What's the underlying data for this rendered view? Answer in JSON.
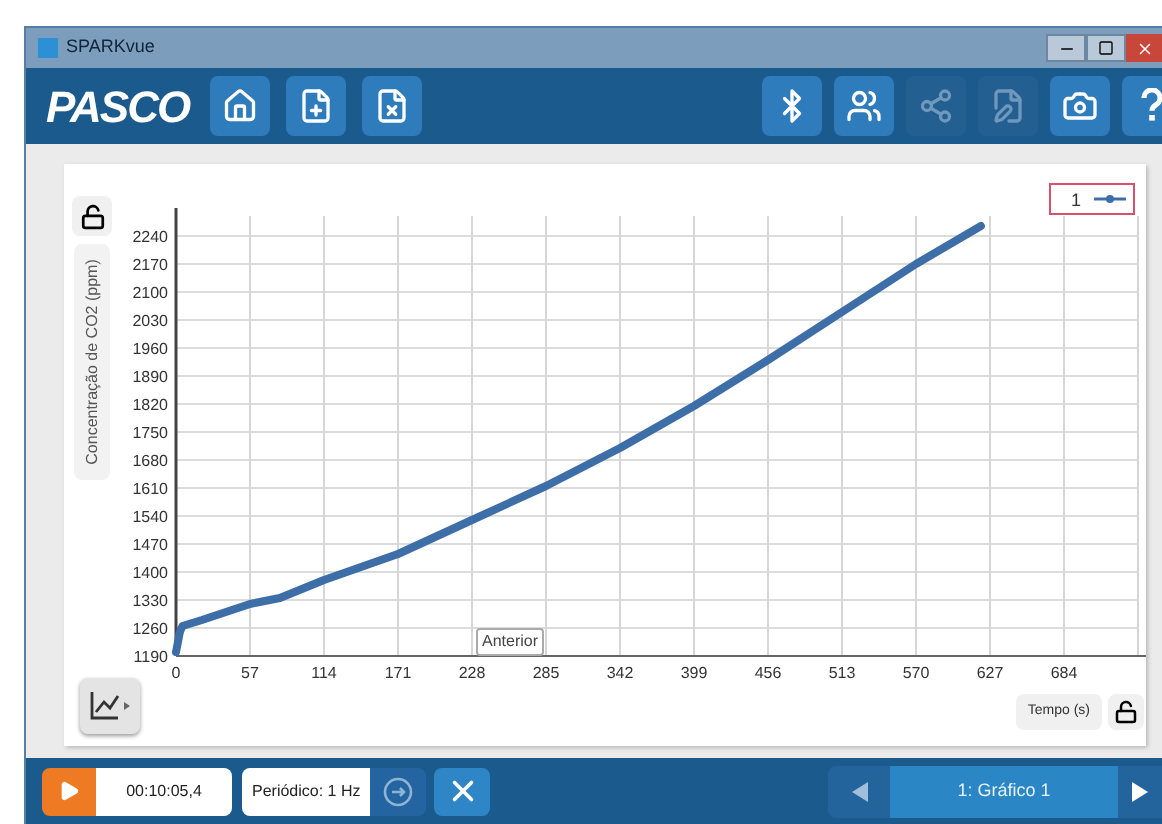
{
  "window": {
    "title": "SPARKvue"
  },
  "toolbar": {
    "logo": "PASCO",
    "left_buttons": [
      {
        "kind": "home",
        "disabled": false
      },
      {
        "kind": "new-page",
        "disabled": false
      },
      {
        "kind": "delete-page",
        "disabled": false
      }
    ],
    "right_buttons": [
      {
        "kind": "bluetooth",
        "disabled": false
      },
      {
        "kind": "users",
        "disabled": false
      },
      {
        "kind": "share",
        "disabled": true
      },
      {
        "kind": "journal",
        "disabled": true
      },
      {
        "kind": "camera",
        "disabled": false
      },
      {
        "kind": "help",
        "disabled": false
      }
    ]
  },
  "graph": {
    "tooltip": "Anterior",
    "chart_data": {
      "type": "line",
      "xlabel": "Tempo (s)",
      "ylabel": "Concentração de CO2 (ppm)",
      "grid": true,
      "xlim": [
        0,
        741
      ],
      "ylim": [
        1190,
        2290
      ],
      "xticks": [
        0,
        57,
        114,
        171,
        228,
        285,
        342,
        399,
        456,
        513,
        570,
        627,
        684
      ],
      "yticks": [
        1190,
        1260,
        1330,
        1400,
        1470,
        1540,
        1610,
        1680,
        1750,
        1820,
        1890,
        1960,
        2030,
        2100,
        2170,
        2240
      ],
      "x": [
        0,
        3,
        5,
        20,
        57,
        80,
        114,
        171,
        228,
        285,
        342,
        399,
        456,
        513,
        570,
        620
      ],
      "series": [
        {
          "name": "1",
          "color": "#3d6ea8",
          "values": [
            1200,
            1250,
            1265,
            1280,
            1320,
            1335,
            1380,
            1445,
            1530,
            1615,
            1710,
            1815,
            1930,
            2050,
            2170,
            2265
          ]
        }
      ]
    }
  },
  "bottom_bar": {
    "time": "00:10:05,4",
    "sampling": "Periódico: 1 Hz",
    "page": "1: Gráfico 1"
  }
}
